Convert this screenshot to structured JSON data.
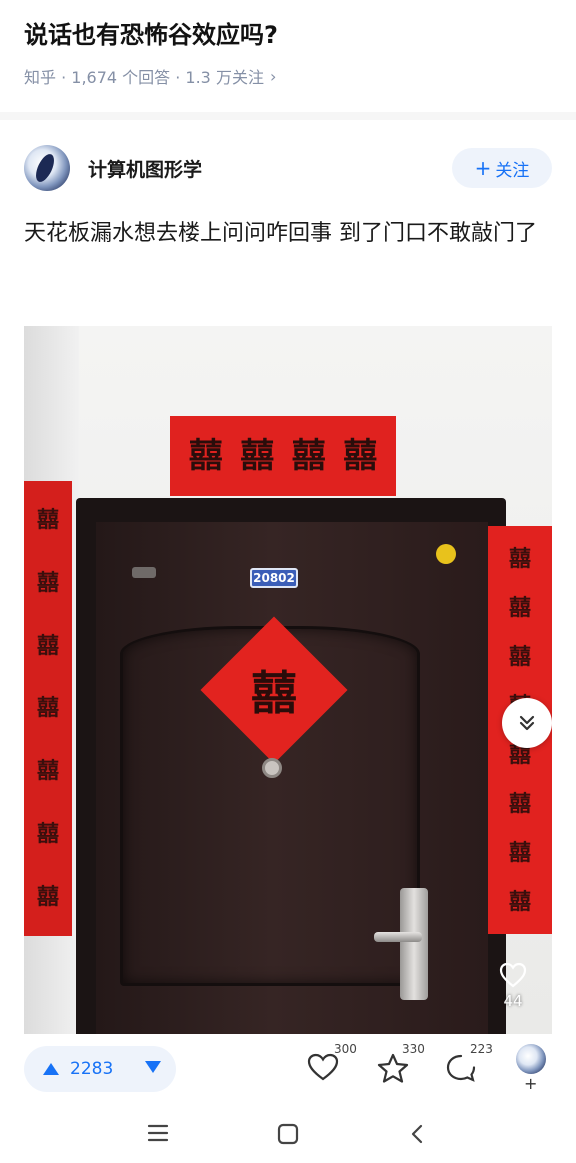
{
  "question": {
    "title": "说话也有恐怖谷效应吗?",
    "meta": "知乎 · 1,674 个回答 · 1.3 万关注",
    "chevron": "›"
  },
  "author": {
    "name": "计算机图形学",
    "follow_label": "关注",
    "follow_prefix": "+"
  },
  "answer": {
    "text": "天花板漏水想去楼上问问咋回事 到了门口不敢敲门了"
  },
  "photo": {
    "door_number": "20802",
    "xi_char": "囍",
    "overlay_like_count": "44"
  },
  "actions": {
    "upvote_count": "2283",
    "like_count": "300",
    "collect_count": "330",
    "comment_count": "223",
    "avatar_plus": "+"
  },
  "colors": {
    "accent": "#1772f6",
    "festive_red": "#e2231f",
    "door_brown": "#2a1b1b"
  },
  "icons": [
    "upvote-icon",
    "downvote-icon",
    "heart-icon",
    "star-icon",
    "comment-icon",
    "menu-icon",
    "home-icon",
    "back-icon",
    "scroll-down-icon"
  ]
}
